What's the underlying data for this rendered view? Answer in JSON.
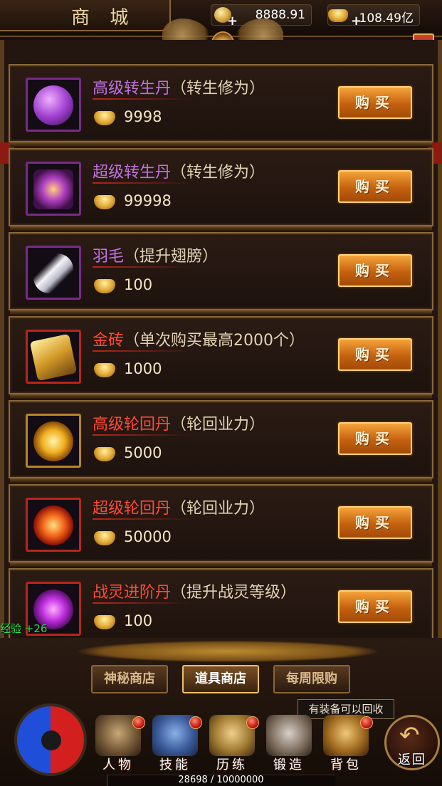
{
  "header": {
    "title": "商 城",
    "currency1": {
      "value": "8888.91",
      "plus": "+",
      "icon": "coin-icon"
    },
    "currency2": {
      "value": "108.49亿",
      "plus": "+",
      "icon": "ingot-icon"
    },
    "close_label": "×"
  },
  "items": [
    {
      "name": "高级转生丹",
      "desc": "（转生修为）",
      "price": "9998",
      "buy": "购买",
      "icon": "purple-orb-icon",
      "name_color": "purple"
    },
    {
      "name": "超级转生丹",
      "desc": "（转生修为）",
      "price": "99998",
      "buy": "购买",
      "icon": "purple-figure-icon",
      "name_color": "purple"
    },
    {
      "name": "羽毛",
      "desc": "（提升翅膀）",
      "price": "100",
      "buy": "购买",
      "icon": "feather-icon",
      "name_color": "purple"
    },
    {
      "name": "金砖",
      "desc": "（单次购买最高2000个）",
      "price": "1000",
      "buy": "购买",
      "icon": "gold-bricks-icon",
      "name_color": "red"
    },
    {
      "name": "高级轮回丹",
      "desc": "（轮回业力）",
      "price": "5000",
      "buy": "购买",
      "icon": "golden-swirl-icon",
      "name_color": "red"
    },
    {
      "name": "超级轮回丹",
      "desc": "（轮回业力）",
      "price": "50000",
      "buy": "购买",
      "icon": "red-swirl-icon",
      "name_color": "red"
    },
    {
      "name": "战灵进阶丹",
      "desc": "（提升战灵等级）",
      "price": "100",
      "buy": "购买",
      "icon": "purple-spirit-orb-icon",
      "name_color": "red"
    }
  ],
  "exp_popup": "经验 +26",
  "shop_tabs": [
    {
      "label": "神秘商店",
      "active": false
    },
    {
      "label": "道具商店",
      "active": true
    },
    {
      "label": "每周限购",
      "active": false
    }
  ],
  "tooltip": "有装备可以回收",
  "nav": [
    {
      "label": "人物",
      "icon": "helmet-warrior-icon"
    },
    {
      "label": "技能",
      "icon": "skill-book-icon"
    },
    {
      "label": "历练",
      "icon": "armor-icon"
    },
    {
      "label": "锻造",
      "icon": "anvil-hammer-icon"
    },
    {
      "label": "背包",
      "icon": "backpack-icon"
    }
  ],
  "return_label": "返回",
  "xp": {
    "text": "28698 / 10000000",
    "current": 28698,
    "max": 10000000
  },
  "colors": {
    "purple_name": "#c070e0",
    "red_name": "#ff4a36",
    "button": "#d9771a",
    "frame": "#8a6a3a"
  }
}
